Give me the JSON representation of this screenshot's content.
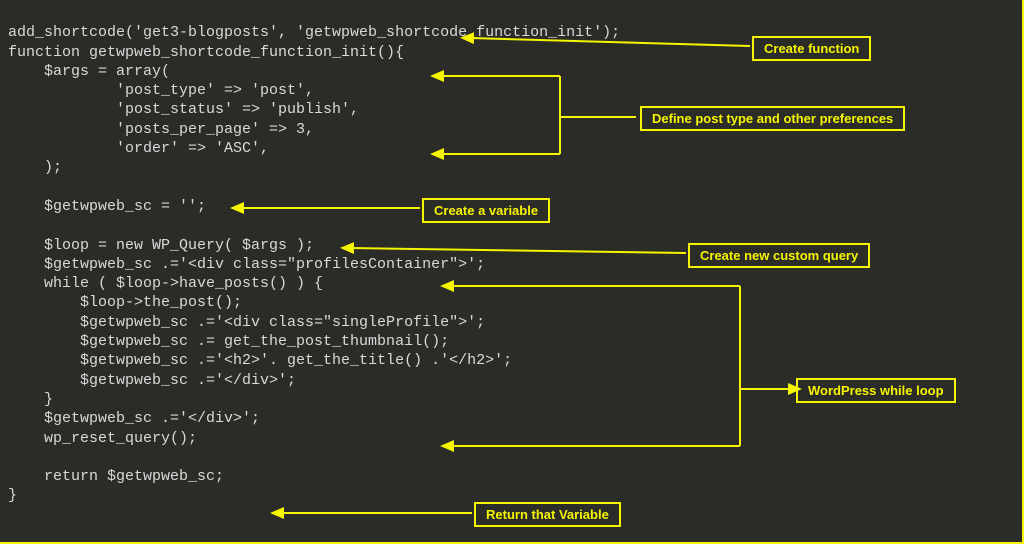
{
  "code": {
    "l1": "add_shortcode('get3-blogposts', 'getwpweb_shortcode_function_init');",
    "l2": "function getwpweb_shortcode_function_init(){",
    "l3": "    $args = array(",
    "l4": "            'post_type' => 'post',",
    "l5": "            'post_status' => 'publish',",
    "l6": "            'posts_per_page' => 3,",
    "l7": "            'order' => 'ASC',",
    "l8": "    );",
    "l9": "",
    "l10": "    $getwpweb_sc = '';",
    "l11": "",
    "l12": "    $loop = new WP_Query( $args );",
    "l13": "    $getwpweb_sc .='<div class=\"profilesContainer\">';",
    "l14": "    while ( $loop->have_posts() ) {",
    "l15": "        $loop->the_post();",
    "l16": "        $getwpweb_sc .='<div class=\"singleProfile\">';",
    "l17": "        $getwpweb_sc .= get_the_post_thumbnail();",
    "l18": "        $getwpweb_sc .='<h2>'. get_the_title() .'</h2>';",
    "l19": "        $getwpweb_sc .='</div>';",
    "l20": "    }",
    "l21": "    $getwpweb_sc .='</div>';",
    "l22": "    wp_reset_query();",
    "l23": "",
    "l24": "    return $getwpweb_sc;",
    "l25": "}"
  },
  "annotations": {
    "a1": "Create function",
    "a2": "Define post type and other preferences",
    "a3": "Create a variable",
    "a4": "Create new custom query",
    "a5": "WordPress while loop",
    "a6": "Return that Variable"
  }
}
